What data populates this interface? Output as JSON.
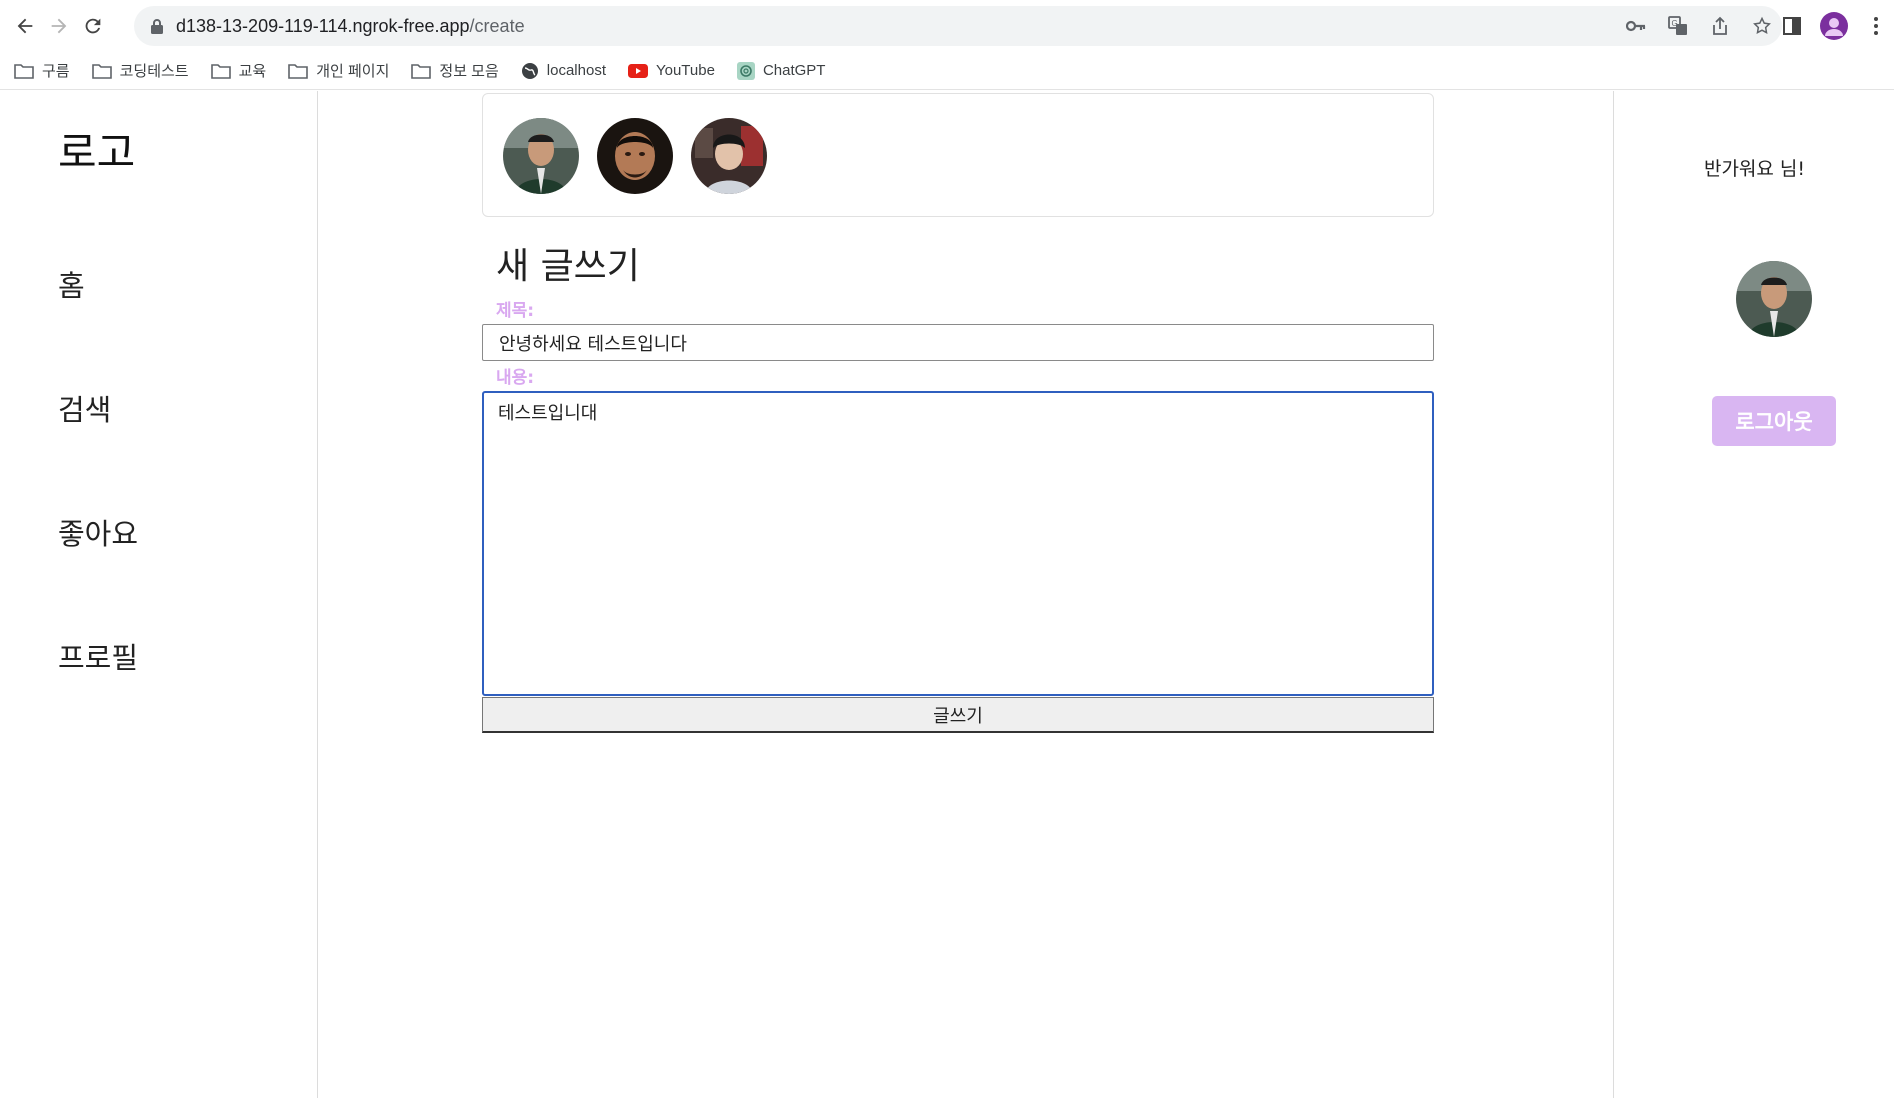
{
  "browser": {
    "url_host": "d138-13-209-119-114.ngrok-free.app",
    "url_path": "/create",
    "bookmarks": [
      {
        "label": "구름",
        "icon": "folder-icon"
      },
      {
        "label": "코딩테스트",
        "icon": "folder-icon"
      },
      {
        "label": "교육",
        "icon": "folder-icon"
      },
      {
        "label": "개인 페이지",
        "icon": "folder-icon"
      },
      {
        "label": "정보 모음",
        "icon": "folder-icon"
      },
      {
        "label": "localhost",
        "icon": "globe-icon"
      },
      {
        "label": "YouTube",
        "icon": "youtube-icon"
      },
      {
        "label": "ChatGPT",
        "icon": "chatgpt-icon"
      }
    ]
  },
  "sidebar": {
    "logo": "로고",
    "items": [
      {
        "label": "홈"
      },
      {
        "label": "검색"
      },
      {
        "label": "좋아요"
      },
      {
        "label": "프로필"
      }
    ]
  },
  "form": {
    "heading": "새 글쓰기",
    "title_label": "제목:",
    "title_value": "안녕하세요 테스트입니다",
    "content_label": "내용:",
    "content_value": "테스트입니대",
    "submit_label": "글쓰기"
  },
  "user_panel": {
    "welcome": "반가워요 님!",
    "logout_label": "로그아웃"
  },
  "colors": {
    "accent_purple": "#d9b6f2",
    "label_purple": "#d9a8f0",
    "focus_blue": "#2f5fbf"
  }
}
